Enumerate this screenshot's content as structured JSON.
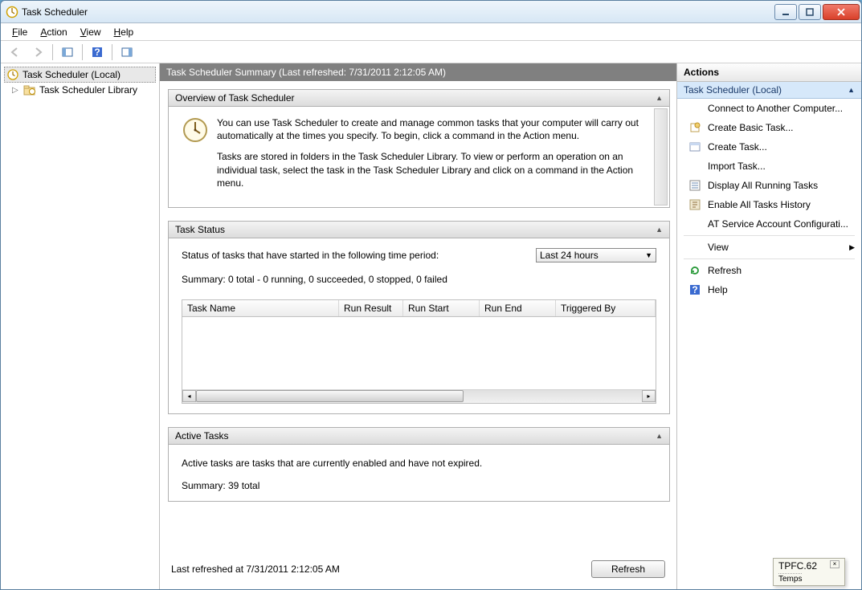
{
  "window": {
    "title": "Task Scheduler"
  },
  "menu": {
    "file": "File",
    "action": "Action",
    "view": "View",
    "help": "Help"
  },
  "nav": {
    "root": "Task Scheduler (Local)",
    "lib": "Task Scheduler Library"
  },
  "summary": {
    "header": "Task Scheduler Summary (Last refreshed: 7/31/2011 2:12:05 AM)"
  },
  "overview": {
    "title": "Overview of Task Scheduler",
    "p1": "You can use Task Scheduler to create and manage common tasks that your computer will carry out automatically at the times you specify. To begin, click a command in the Action menu.",
    "p2": "Tasks are stored in folders in the Task Scheduler Library. To view or perform an operation on an individual task, select the task in the Task Scheduler Library and click on a command in the Action menu."
  },
  "status": {
    "title": "Task Status",
    "period_label": "Status of tasks that have started in the following time period:",
    "period_value": "Last 24 hours",
    "summary_line": "Summary: 0 total - 0 running, 0 succeeded, 0 stopped, 0 failed",
    "cols": {
      "name": "Task Name",
      "result": "Run Result",
      "start": "Run Start",
      "end": "Run End",
      "trig": "Triggered By"
    }
  },
  "active": {
    "title": "Active Tasks",
    "desc": "Active tasks are tasks that are currently enabled and have not expired.",
    "summary_line": "Summary: 39 total"
  },
  "footer": {
    "last_refreshed": "Last refreshed at 7/31/2011 2:12:05 AM",
    "refresh_btn": "Refresh"
  },
  "actions": {
    "title": "Actions",
    "group": "Task Scheduler (Local)",
    "items": [
      "Connect to Another Computer...",
      "Create Basic Task...",
      "Create Task...",
      "Import Task...",
      "Display All Running Tasks",
      "Enable All Tasks History",
      "AT Service Account Configurati...",
      "View",
      "Refresh",
      "Help"
    ]
  },
  "popup": {
    "title": "TPFC.62",
    "line": "Temps"
  }
}
